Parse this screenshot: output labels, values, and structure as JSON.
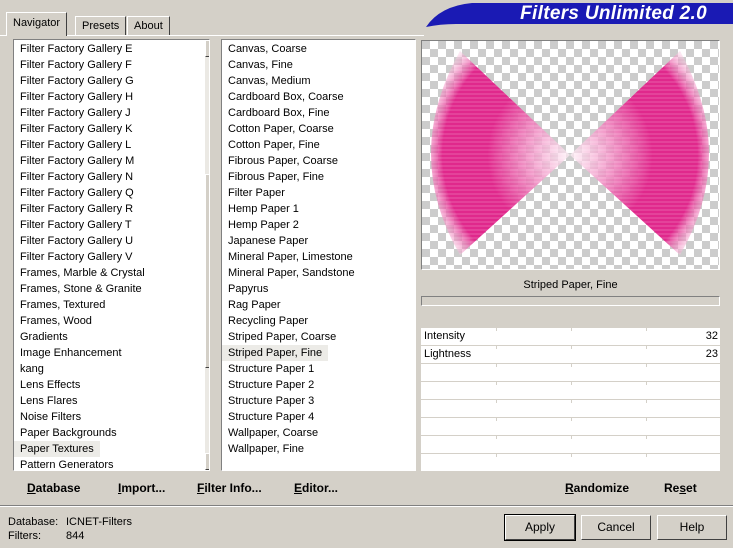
{
  "tabs": [
    {
      "label": "Navigator",
      "active": true
    },
    {
      "label": "Presets",
      "active": false
    },
    {
      "label": "About",
      "active": false
    }
  ],
  "title": "Filters Unlimited 2.0",
  "categories": [
    "Filter Factory Gallery E",
    "Filter Factory Gallery F",
    "Filter Factory Gallery G",
    "Filter Factory Gallery H",
    "Filter Factory Gallery J",
    "Filter Factory Gallery K",
    "Filter Factory Gallery L",
    "Filter Factory Gallery M",
    "Filter Factory Gallery N",
    "Filter Factory Gallery Q",
    "Filter Factory Gallery R",
    "Filter Factory Gallery T",
    "Filter Factory Gallery U",
    "Filter Factory Gallery V",
    "Frames, Marble & Crystal",
    "Frames, Stone & Granite",
    "Frames, Textured",
    "Frames, Wood",
    "Gradients",
    "Image Enhancement",
    "kang",
    "Lens Effects",
    "Lens Flares",
    "Noise Filters",
    "Paper Backgrounds",
    "Paper Textures",
    "Pattern Generators"
  ],
  "selected_category": "Paper Textures",
  "filters": [
    "Canvas, Coarse",
    "Canvas, Fine",
    "Canvas, Medium",
    "Cardboard Box, Coarse",
    "Cardboard Box, Fine",
    "Cotton Paper, Coarse",
    "Cotton Paper, Fine",
    "Fibrous Paper, Coarse",
    "Fibrous Paper, Fine",
    "Filter Paper",
    "Hemp Paper 1",
    "Hemp Paper 2",
    "Japanese Paper",
    "Mineral Paper, Limestone",
    "Mineral Paper, Sandstone",
    "Papyrus",
    "Rag Paper",
    "Recycling Paper",
    "Striped Paper, Coarse",
    "Striped Paper, Fine",
    "Structure Paper 1",
    "Structure Paper 2",
    "Structure Paper 3",
    "Structure Paper 4",
    "Wallpaper, Coarse",
    "Wallpaper, Fine"
  ],
  "selected_filter": "Striped Paper, Fine",
  "preview_caption": "Striped Paper, Fine",
  "params": [
    {
      "label": "Intensity",
      "value": "32"
    },
    {
      "label": "Lightness",
      "value": "23"
    },
    {
      "label": "",
      "value": ""
    },
    {
      "label": "",
      "value": ""
    },
    {
      "label": "",
      "value": ""
    },
    {
      "label": "",
      "value": ""
    },
    {
      "label": "",
      "value": ""
    },
    {
      "label": "",
      "value": ""
    }
  ],
  "toolbar": {
    "database": {
      "pre": "",
      "u": "D",
      "post": "atabase"
    },
    "import": {
      "pre": "",
      "u": "I",
      "post": "mport..."
    },
    "filter_info": {
      "pre": "",
      "u": "F",
      "post": "ilter Info..."
    },
    "editor": {
      "pre": "",
      "u": "E",
      "post": "ditor..."
    },
    "randomize": {
      "pre": "",
      "u": "R",
      "post": "andomize"
    },
    "reset": {
      "pre": "Re",
      "u": "s",
      "post": "et"
    }
  },
  "info": {
    "database_label": "Database:",
    "database_value": "ICNET-Filters",
    "filters_label": "Filters:",
    "filters_value": "844"
  },
  "buttons": {
    "apply": "Apply",
    "cancel": "Cancel",
    "help": "Help"
  },
  "colors": {
    "banner": "#1a1ab4",
    "preview_pink": "#e0288c"
  }
}
